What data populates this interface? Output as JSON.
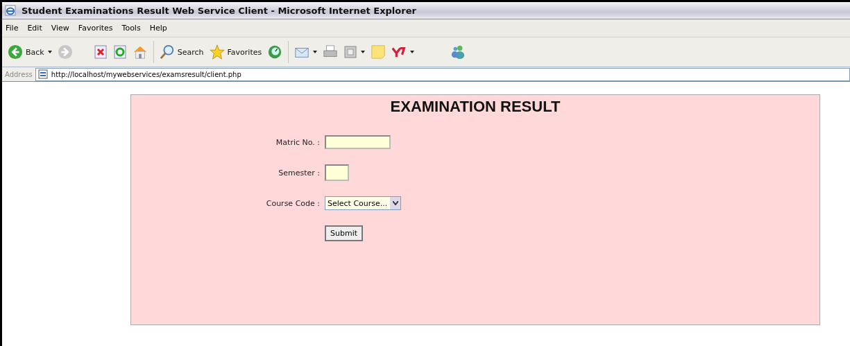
{
  "window": {
    "title": "Student Examinations Result Web Service Client - Microsoft Internet Explorer"
  },
  "menu": [
    {
      "label": "File"
    },
    {
      "label": "Edit"
    },
    {
      "label": "View"
    },
    {
      "label": "Favorites"
    },
    {
      "label": "Tools"
    },
    {
      "label": "Help"
    }
  ],
  "toolbar": {
    "back": "Back",
    "search": "Search",
    "favorites": "Favorites"
  },
  "address": {
    "label": "Address",
    "url": "http://localhost/mywebservices/examsresult/client.php"
  },
  "form": {
    "title": "EXAMINATION RESULT",
    "fields": [
      {
        "kind": "text",
        "label": "Matric No. :"
      },
      {
        "kind": "short",
        "label": "Semester :"
      },
      {
        "kind": "select",
        "label": "Course Code :",
        "value": "Select Course..."
      }
    ],
    "submit": "Submit"
  }
}
